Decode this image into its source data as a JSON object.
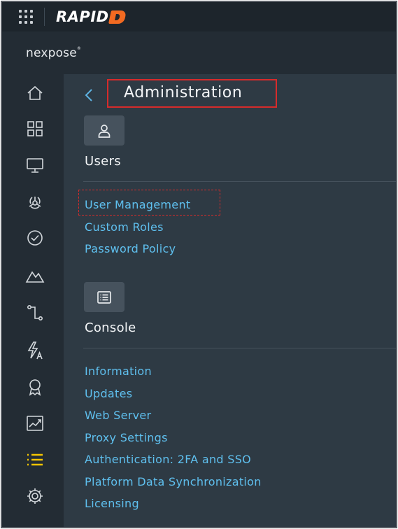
{
  "topbar": {
    "brand_text": "RAPID",
    "colors": {
      "background": "#1d252c",
      "brand_accent": "#f26a21"
    },
    "apps_icon": "grid-dots-icon"
  },
  "product": {
    "name": "nexpose",
    "trademark": "®"
  },
  "sidenav": {
    "items": [
      {
        "icon": "home-icon"
      },
      {
        "icon": "dashboard-icon"
      },
      {
        "icon": "assets-icon"
      },
      {
        "icon": "vulnerabilities-icon"
      },
      {
        "icon": "policies-icon"
      },
      {
        "icon": "reports-icon"
      },
      {
        "icon": "remediation-icon"
      },
      {
        "icon": "automation-icon"
      },
      {
        "icon": "certificate-icon"
      },
      {
        "icon": "trend-chart-icon"
      },
      {
        "icon": "list-icon",
        "active": true
      },
      {
        "icon": "gear-icon"
      }
    ],
    "active_color": "#f4c400"
  },
  "page": {
    "title": "Administration",
    "back_icon": "chevron-left-icon"
  },
  "sections": {
    "users": {
      "title": "Users",
      "icon": "user-icon",
      "links": [
        "User Management",
        "Custom Roles",
        "Password Policy"
      ]
    },
    "console": {
      "title": "Console",
      "icon": "console-list-icon",
      "links": [
        "Information",
        "Updates",
        "Web Server",
        "Proxy Settings",
        "Authentication: 2FA and SSO",
        "Platform Data Synchronization",
        "Licensing"
      ]
    }
  },
  "colors": {
    "link": "#5fc0ef",
    "annotation_highlight": "#d62b2b",
    "panel": "#2e3a44"
  }
}
